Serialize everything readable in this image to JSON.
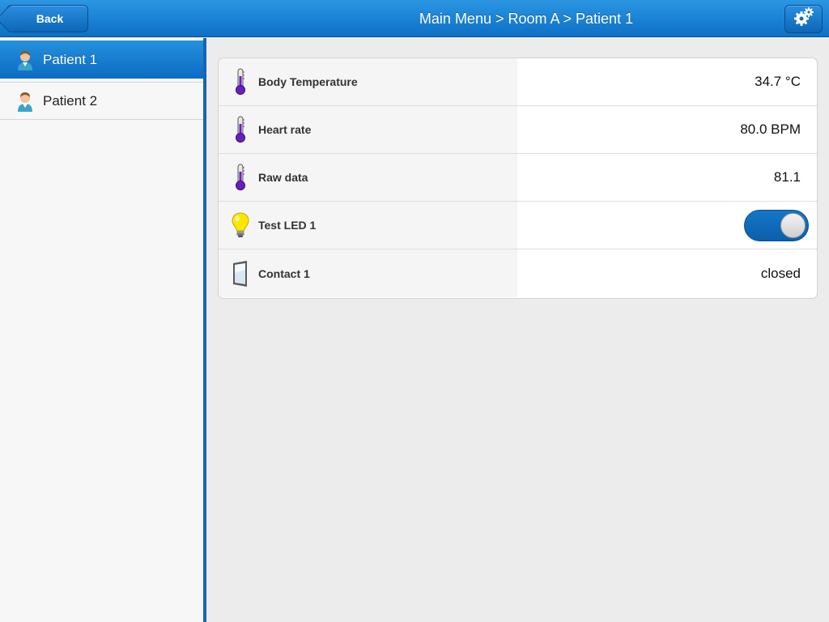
{
  "header": {
    "back_label": "Back",
    "title": "Main Menu > Room A > Patient 1",
    "settings_icon": "gear-icon"
  },
  "sidebar": {
    "items": [
      {
        "label": "Patient 1",
        "icon": "patient-icon",
        "active": true
      },
      {
        "label": "Patient 2",
        "icon": "patient-icon",
        "active": false
      }
    ]
  },
  "rows": [
    {
      "label": "Body Temperature",
      "icon": "thermometer-icon",
      "value": "34.7 °C"
    },
    {
      "label": "Heart rate",
      "icon": "thermometer-icon",
      "value": "80.0 BPM"
    },
    {
      "label": "Raw data",
      "icon": "thermometer-icon",
      "value": "81.1"
    },
    {
      "label": "Test LED 1",
      "icon": "lightbulb-icon",
      "value": "on"
    },
    {
      "label": "Contact 1",
      "icon": "door-icon",
      "value": "closed"
    }
  ],
  "colors": {
    "accent": "#0d70c6",
    "sidebar_divider": "#1565b3"
  }
}
